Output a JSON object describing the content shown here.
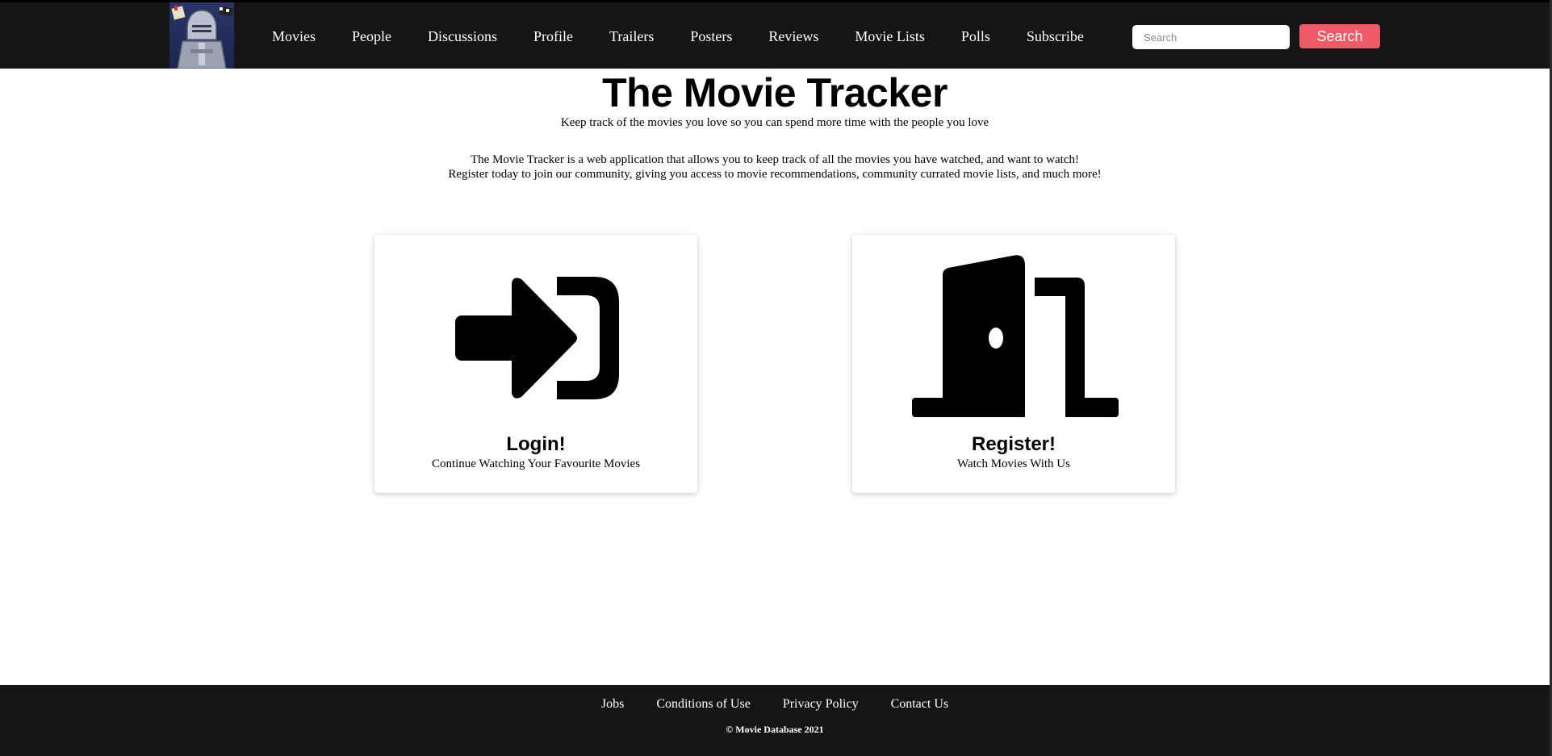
{
  "nav": {
    "links": [
      "Movies",
      "People",
      "Discussions",
      "Profile",
      "Trailers",
      "Posters",
      "Reviews",
      "Movie Lists",
      "Polls",
      "Subscribe"
    ],
    "search_placeholder": "Search",
    "search_button": "Search"
  },
  "hero": {
    "title": "The Movie Tracker",
    "tagline": "Keep track of the movies you love so you can spend more time with the people you love",
    "intro_line1": "The Movie Tracker is a web application that allows you to keep track of all the movies you have watched, and want to watch!",
    "intro_line2": "Register today to join our community, giving you access to movie recommendations, community currated movie lists, and much more!"
  },
  "cards": {
    "login": {
      "title": "Login!",
      "subtitle": "Continue Watching Your Favourite Movies",
      "icon": "login-icon"
    },
    "register": {
      "title": "Register!",
      "subtitle": "Watch Movies With Us",
      "icon": "door-open-icon"
    }
  },
  "footer": {
    "links": [
      "Jobs",
      "Conditions of Use",
      "Privacy Policy",
      "Contact Us"
    ],
    "copyright": "© Movie Database 2021"
  },
  "colors": {
    "navbar": "#151515",
    "search_button": "#ef5a67",
    "page_bg": "#ffffff"
  }
}
